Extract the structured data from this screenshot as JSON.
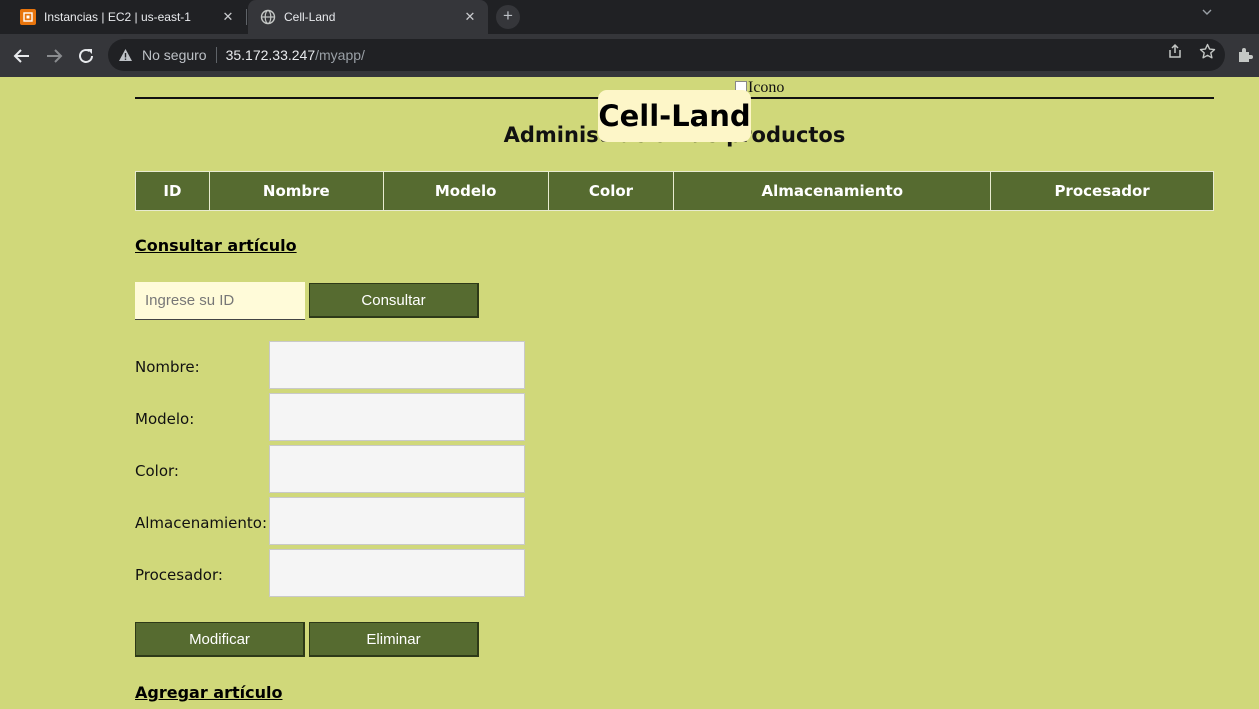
{
  "browser": {
    "tabs": [
      {
        "title": "Instancias | EC2 | us-east-1",
        "close": "✕",
        "state": "inactive"
      },
      {
        "title": "Cell-Land",
        "close": "✕",
        "state": "active"
      }
    ],
    "new_tab": "+",
    "address": {
      "security_text": "No seguro",
      "host": "35.172.33.247",
      "path": "/myapp/"
    }
  },
  "page": {
    "broken_image_alt": "Icono",
    "brand": "Cell-Land",
    "title": "Administración de productos",
    "table_headers": [
      "ID",
      "Nombre",
      "Modelo",
      "Color",
      "Almacenamiento",
      "Procesador"
    ],
    "consult": {
      "heading": "Consultar artículo",
      "id_placeholder": "Ingrese su ID",
      "button": "Consultar"
    },
    "fields": [
      {
        "label": "Nombre:",
        "value": ""
      },
      {
        "label": "Modelo:",
        "value": ""
      },
      {
        "label": "Color:",
        "value": ""
      },
      {
        "label": "Almacenamiento:",
        "value": ""
      },
      {
        "label": "Procesador:",
        "value": ""
      }
    ],
    "actions": {
      "modify": "Modificar",
      "delete": "Eliminar"
    },
    "add_heading": "Agregar artículo"
  },
  "colors": {
    "page_background": "#d0d87a",
    "header_green": "#566b30",
    "brand_badge": "#fdf6c8",
    "input_background": "#fffbd9"
  }
}
